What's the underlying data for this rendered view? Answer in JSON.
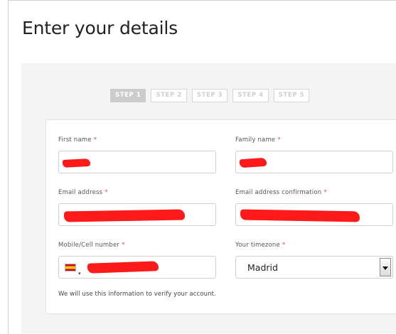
{
  "page": {
    "title": "Enter your details"
  },
  "steps": [
    {
      "label": "STEP 1",
      "active": true
    },
    {
      "label": "STEP 2",
      "active": false
    },
    {
      "label": "STEP 3",
      "active": false
    },
    {
      "label": "STEP 4",
      "active": false
    },
    {
      "label": "STEP 5",
      "active": false
    }
  ],
  "form": {
    "required_marker": "*",
    "first_name": {
      "label": "First name"
    },
    "family_name": {
      "label": "Family name"
    },
    "email": {
      "label": "Email address"
    },
    "email_confirm": {
      "label": "Email address confirmation"
    },
    "mobile": {
      "label": "Mobile/Cell number",
      "country_flag": "spain-flag-icon"
    },
    "timezone": {
      "label": "Your timezone",
      "value": "Madrid"
    },
    "note": "We will use this information to verify your account."
  },
  "colors": {
    "required": "#e04a4a",
    "redaction": "#ff1a1a",
    "step_active_bg": "#cccccc",
    "panel_bg": "#f4f4f4"
  }
}
